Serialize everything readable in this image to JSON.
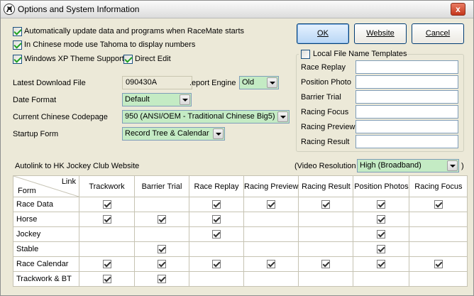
{
  "window": {
    "title": "Options and System Information",
    "close_label": "x"
  },
  "options": {
    "auto_update": {
      "label": "Automatically update data and programs when RaceMate starts",
      "checked": true
    },
    "tahoma": {
      "label": "In Chinese mode use Tahoma to display numbers",
      "checked": true
    },
    "xp_theme": {
      "label": "Windows XP Theme Support",
      "checked": true
    },
    "direct_edit": {
      "label": "Direct Edit",
      "checked": true
    }
  },
  "buttons": {
    "ok": "OK",
    "website": "Website",
    "cancel": "Cancel"
  },
  "settings": {
    "latest_file_label": "Latest Download File",
    "latest_file_value": "090430A",
    "report_engine_label": ".eport Engine",
    "report_engine_value": "Old",
    "date_format_label": "Date Format",
    "date_format_value": "Default",
    "codepage_label": "Current Chinese Codepage",
    "codepage_value": "950 (ANSI/OEM - Traditional Chinese Big5)",
    "startup_label": "Startup Form",
    "startup_value": "Record Tree & Calendar"
  },
  "local_templates": {
    "title": "Local File Name Templates",
    "checked": false,
    "rows": [
      {
        "label": "Race Replay",
        "value": ""
      },
      {
        "label": "Position Photo",
        "value": ""
      },
      {
        "label": "Barrier Trial",
        "value": ""
      },
      {
        "label": "Racing Focus",
        "value": ""
      },
      {
        "label": "Racing Preview",
        "value": ""
      },
      {
        "label": "Racing Result",
        "value": ""
      }
    ]
  },
  "autolink": {
    "label": "Autolink to HK Jockey Club Website",
    "video_label": "(Video Resolution",
    "video_value": "High (Broadband)",
    "video_close": ")",
    "corner_link": "Link",
    "corner_form": "Form",
    "columns": [
      "Trackwork",
      "Barrier Trial",
      "Race Replay",
      "Racing Preview",
      "Racing Result",
      "Position Photos",
      "Racing Focus"
    ],
    "rows": [
      {
        "label": "Race Data",
        "checks": [
          true,
          false,
          true,
          true,
          true,
          true,
          true
        ]
      },
      {
        "label": "Horse",
        "checks": [
          true,
          true,
          true,
          false,
          false,
          true,
          false
        ]
      },
      {
        "label": "Jockey",
        "checks": [
          false,
          false,
          true,
          false,
          false,
          true,
          false
        ]
      },
      {
        "label": "Stable",
        "checks": [
          false,
          true,
          false,
          false,
          false,
          true,
          false
        ]
      },
      {
        "label": "Race Calendar",
        "checks": [
          true,
          true,
          true,
          true,
          true,
          true,
          true
        ]
      },
      {
        "label": "Trackwork & BT",
        "checks": [
          true,
          true,
          false,
          false,
          false,
          false,
          false
        ]
      }
    ]
  }
}
